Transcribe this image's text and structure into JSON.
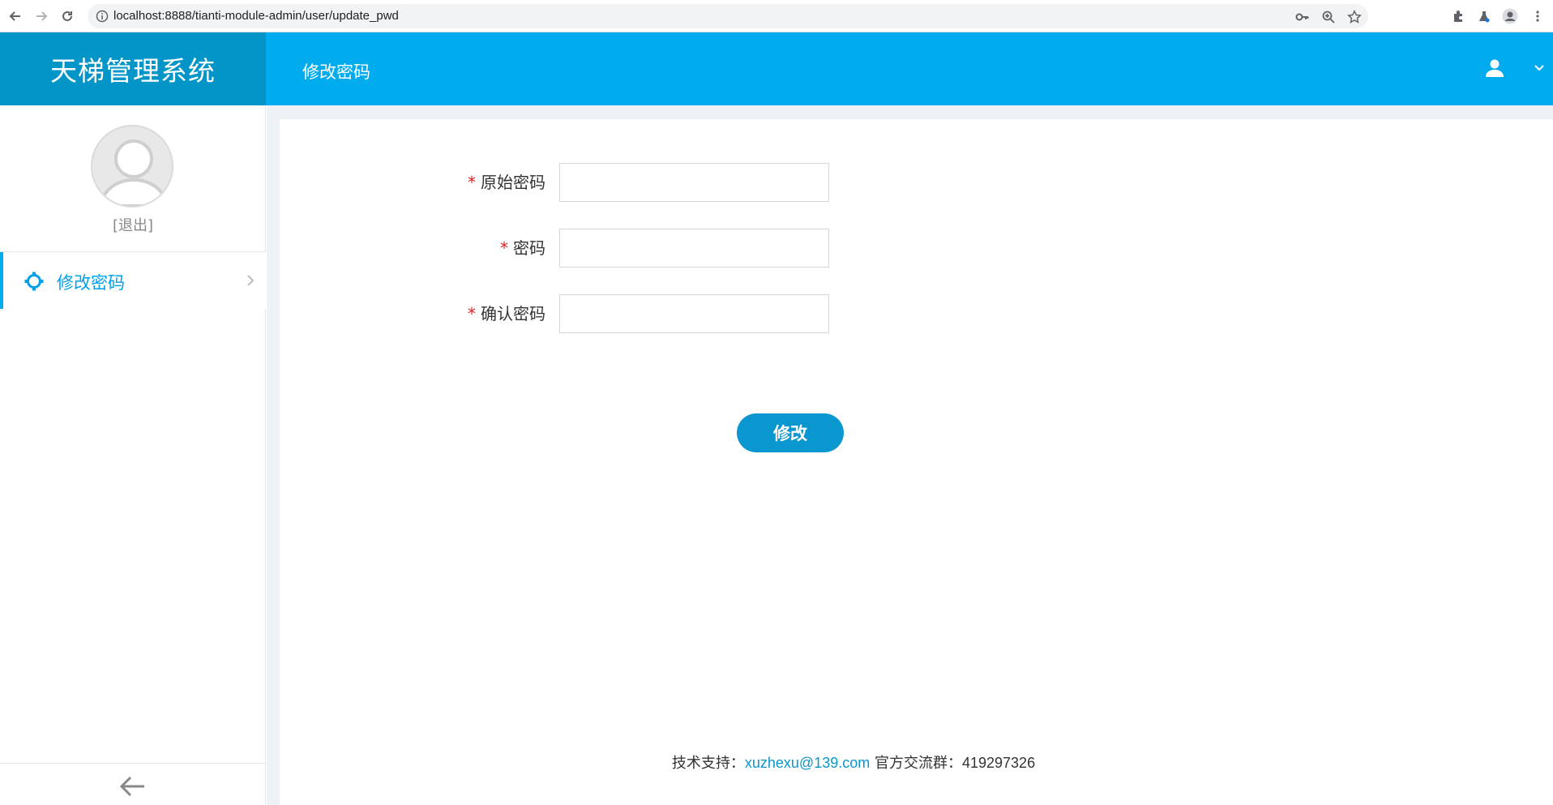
{
  "browser": {
    "url": "localhost:8888/tianti-module-admin/user/update_pwd"
  },
  "app": {
    "brand": "天梯管理系统",
    "header_title": "修改密码"
  },
  "sidebar": {
    "logout_label": "[退出]",
    "items": [
      {
        "label": "修改密码",
        "icon": "gear-icon",
        "active": true
      }
    ]
  },
  "form": {
    "fields": [
      {
        "required_mark": "*",
        "label": "原始密码",
        "value": "",
        "placeholder": ""
      },
      {
        "required_mark": "*",
        "label": "密码",
        "value": "",
        "placeholder": ""
      },
      {
        "required_mark": "*",
        "label": "确认密码",
        "value": "",
        "placeholder": ""
      }
    ],
    "submit_label": "修改"
  },
  "footer": {
    "support_prefix": "技术支持：",
    "email": "xuzhexu@139.com",
    "group_prefix": " 官方交流群：",
    "group_number": "419297326"
  },
  "colors": {
    "brand_dark": "#0395c7",
    "header": "#00abee",
    "accent": "#00a0e9",
    "button": "#0a96ce",
    "required": "#e02020"
  }
}
